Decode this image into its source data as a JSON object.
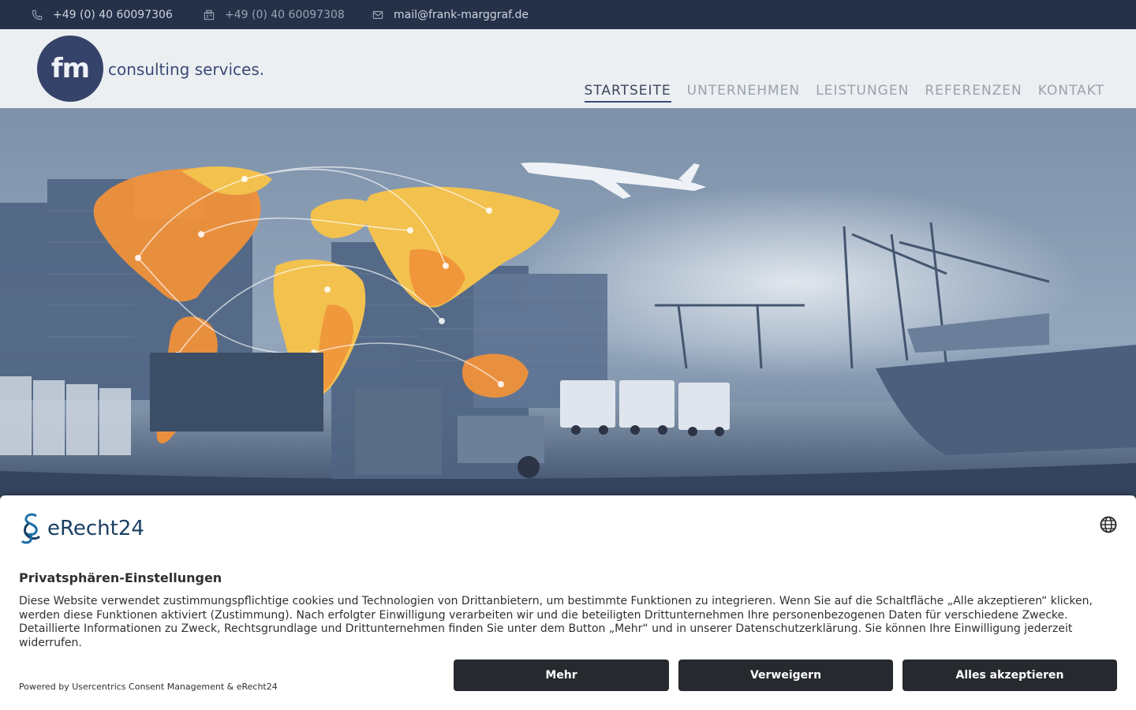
{
  "topbar": {
    "phone": "+49 (0) 40 60097306",
    "fax": "+49 (0) 40 60097308",
    "email": "mail@frank-marggraf.de",
    "phone_icon": "phone-icon",
    "fax_icon": "fax-icon",
    "email_icon": "envelope-icon"
  },
  "header": {
    "logo_initials": "fm",
    "logo_tagline": "consulting services.",
    "nav": [
      {
        "label": "STARTSEITE",
        "active": true
      },
      {
        "label": "UNTERNEHMEN",
        "active": false
      },
      {
        "label": "LEISTUNGEN",
        "active": false
      },
      {
        "label": "REFERENZEN",
        "active": false
      },
      {
        "label": "KONTAKT",
        "active": false
      }
    ]
  },
  "consent": {
    "brand": "eRecht24",
    "title": "Privatsphären-Einstellungen",
    "description": "Diese Website verwendet zustimmungspflichtige cookies und Technologien von Drittanbietern, um bestimmte Funktionen zu integrieren. Wenn Sie auf die Schaltfläche „Alle akzeptieren“ klicken, werden diese Funktionen aktiviert (Zustimmung). Nach erfolgter Einwilligung verarbeiten wir und die beteiligten Drittunternehmen Ihre personenbezogenen Daten für verschiedene Zwecke. Detaillierte Informationen zu Zweck, Rechtsgrundlage und Drittunternehmen finden Sie unter dem Button „Mehr“ und in unserer Datenschutzerklärung. Sie können Ihre Einwilligung jederzeit widerrufen.",
    "powered_by": "Powered by Usercentrics Consent Management & eRecht24",
    "buttons": {
      "more": "Mehr",
      "deny": "Verweigern",
      "accept": "Alles akzeptieren"
    },
    "language_icon": "globe-icon"
  },
  "colors": {
    "topbar_bg": "#253049",
    "header_bg": "#eceff2",
    "brand_blue": "#354269",
    "map_orange": "#f0913a",
    "map_yellow": "#f2c14e",
    "button_dark": "#26292e"
  }
}
